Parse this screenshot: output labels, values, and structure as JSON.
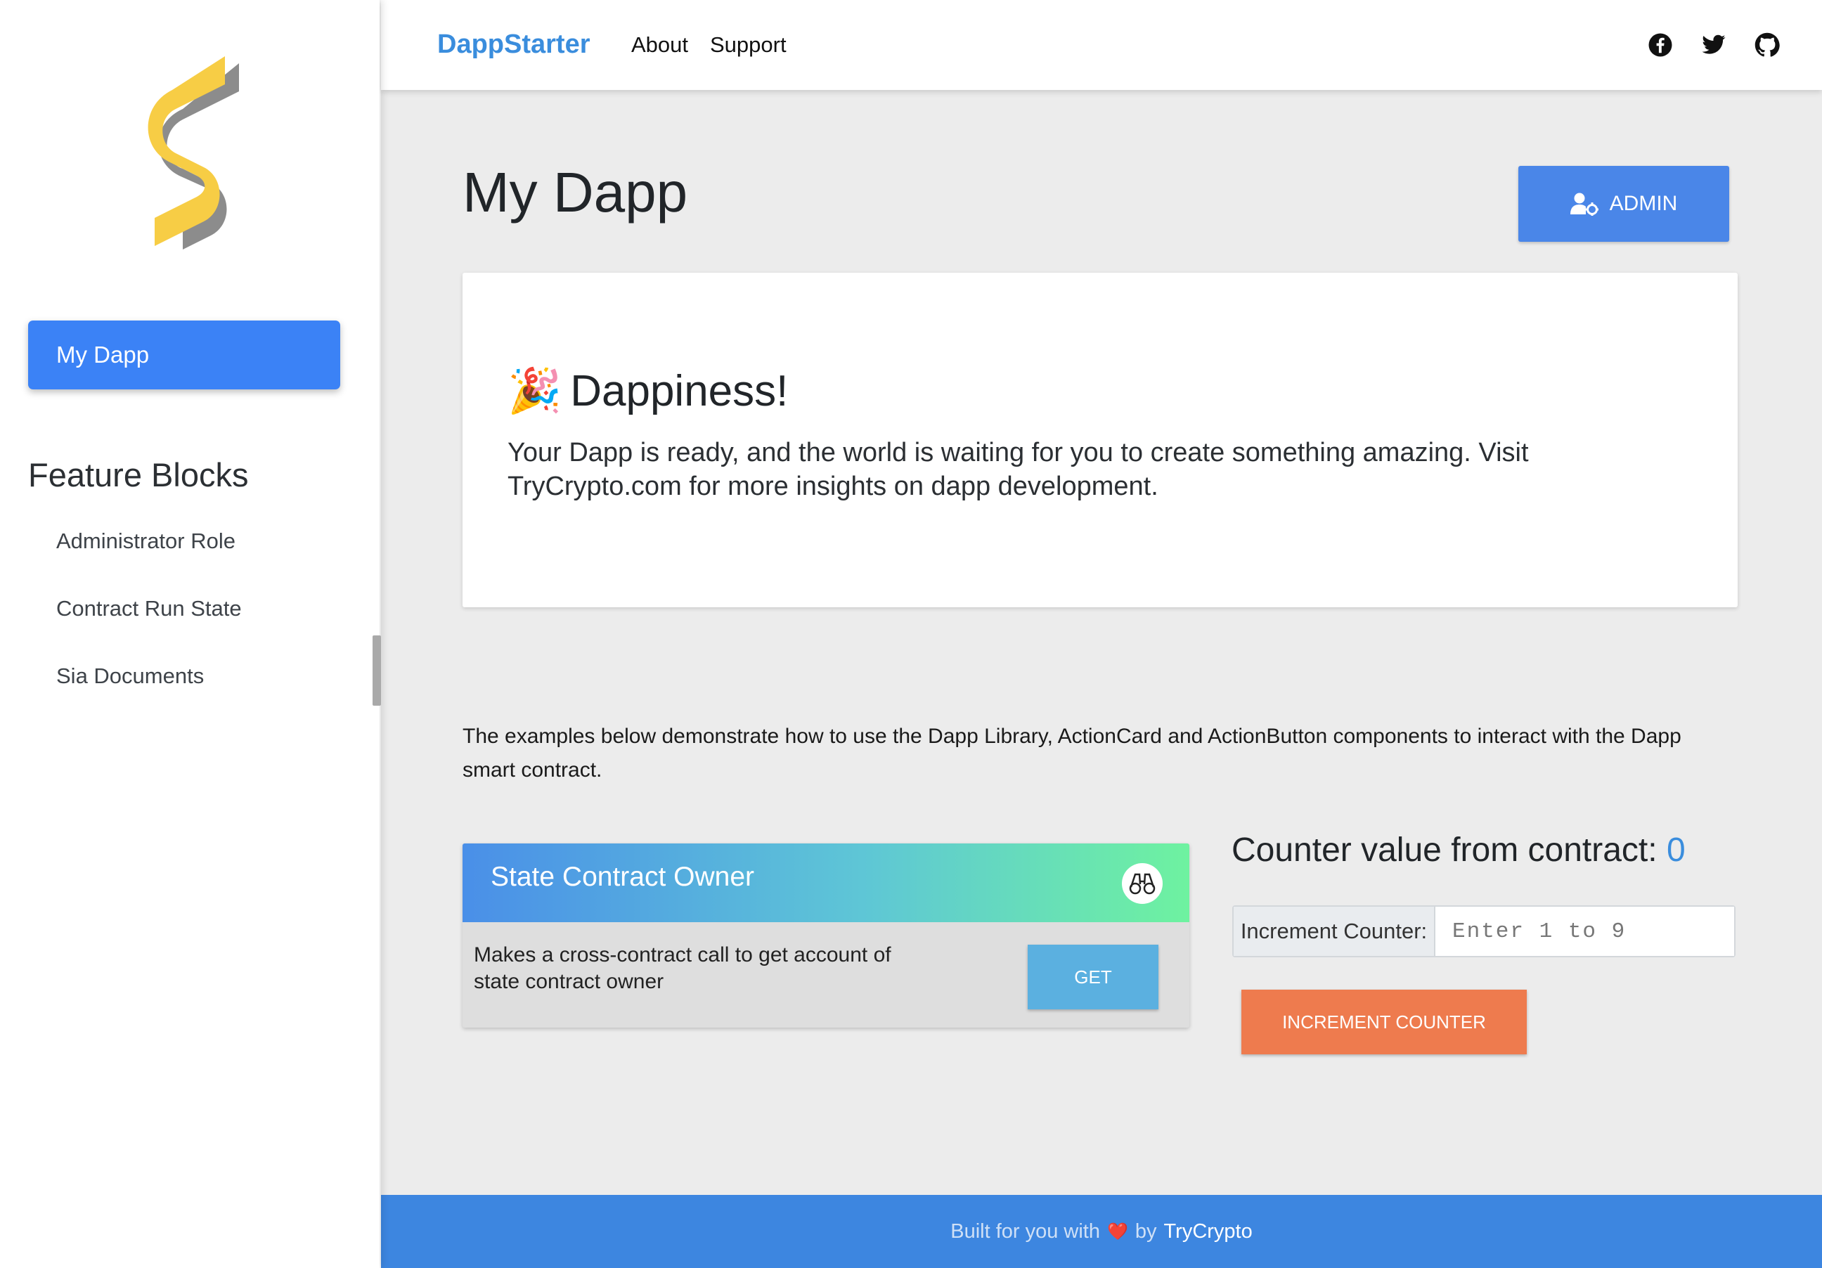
{
  "brand": "DappStarter",
  "nav_links": [
    "About",
    "Support"
  ],
  "social_icons": [
    "facebook-icon",
    "twitter-icon",
    "github-icon"
  ],
  "sidebar": {
    "active_item": "My Dapp",
    "feature_title": "Feature Blocks",
    "items": [
      "Administrator Role",
      "Contract Run State",
      "Sia Documents"
    ]
  },
  "main": {
    "title": "My Dapp",
    "admin_button": "ADMIN",
    "hero": {
      "emoji": "🎉",
      "title": "Dappiness!",
      "text": "Your Dapp is ready, and the world is waiting for you to create something amazing. Visit TryCrypto.com for more insights on dapp development."
    },
    "intro": "The examples below demonstrate how to use the Dapp Library, ActionCard and ActionButton components to interact with the Dapp smart contract.",
    "action_card": {
      "title": "State Contract Owner",
      "description": "Makes a cross-contract call to get account of state contract owner",
      "button": "GET",
      "icon": "binoculars-icon"
    },
    "counter": {
      "label": "Counter value from contract:",
      "value": "0",
      "input_label": "Increment Counter:",
      "input_placeholder": "Enter 1 to 9",
      "button": "INCREMENT COUNTER"
    }
  },
  "footer": {
    "text": "Built for you with",
    "heart": "❤️",
    "by": "by",
    "link": "TryCrypto"
  },
  "colors": {
    "accent": "#3b82f6",
    "brand": "#3a8ddd",
    "admin": "#4a86e8",
    "get_button": "#5bb0e0",
    "increment_button": "#ee7b4e",
    "footer": "#3d86e0"
  }
}
